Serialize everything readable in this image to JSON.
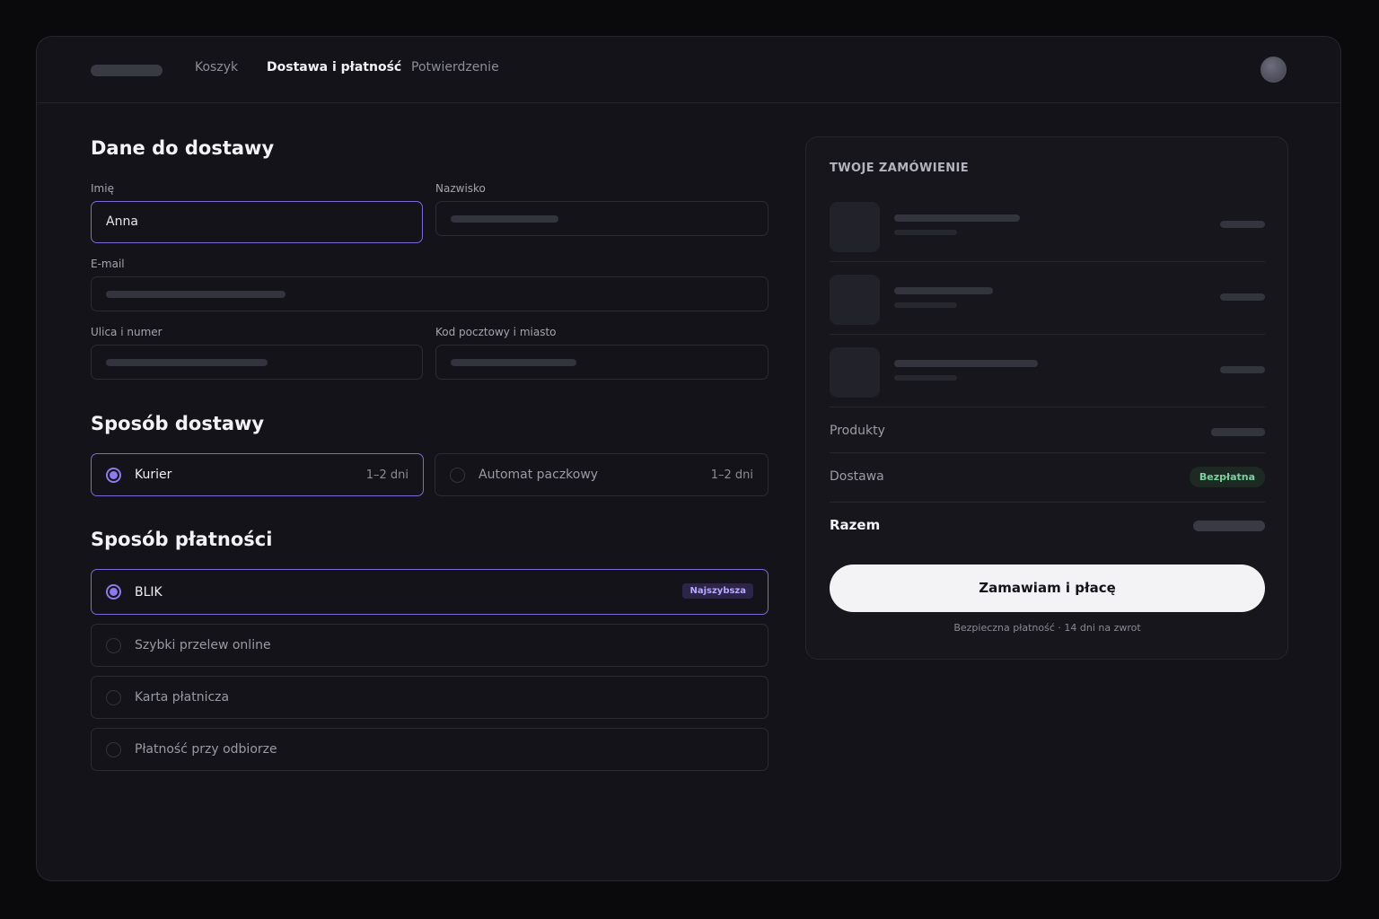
{
  "nav": {
    "steps": [
      "Koszyk",
      "Dostawa i płatność",
      "Potwierdzenie"
    ],
    "active_step": "Dostawa i płatność"
  },
  "delivery_data": {
    "title": "Dane do dostawy",
    "first_name": {
      "label": "Imię",
      "value": "Anna"
    },
    "last_name": {
      "label": "Nazwisko",
      "value": ""
    },
    "email": {
      "label": "E-mail",
      "value": ""
    },
    "street": {
      "label": "Ulica i numer",
      "value": ""
    },
    "postal_city": {
      "label": "Kod pocztowy i miasto",
      "value": ""
    }
  },
  "shipping": {
    "title": "Sposób dostawy",
    "options": [
      {
        "label": "Kurier",
        "eta": "1–2 dni",
        "selected": true
      },
      {
        "label": "Automat paczkowy",
        "eta": "1–2 dni",
        "selected": false
      }
    ]
  },
  "payment": {
    "title": "Sposób płatności",
    "options": [
      {
        "label": "BLIK",
        "badge": "Najszybsza",
        "selected": true
      },
      {
        "label": "Szybki przelew online",
        "selected": false
      },
      {
        "label": "Karta płatnicza",
        "selected": false
      },
      {
        "label": "Płatność przy odbiorze",
        "selected": false
      }
    ]
  },
  "summary": {
    "title": "TWOJE ZAMÓWIENIE",
    "items_count": 3,
    "products_label": "Produkty",
    "shipping_label": "Dostawa",
    "shipping_value": "Bezpłatna",
    "total_label": "Razem",
    "cta": "Zamawiam i płacę",
    "note": "Bezpieczna płatność · 14 dni na zwrot"
  },
  "colors": {
    "background": "#0a0a0d",
    "panel": "#131319",
    "accent": "#8d7bea",
    "success": "#7ad1a0",
    "cta_background": "#f3f3f6"
  }
}
